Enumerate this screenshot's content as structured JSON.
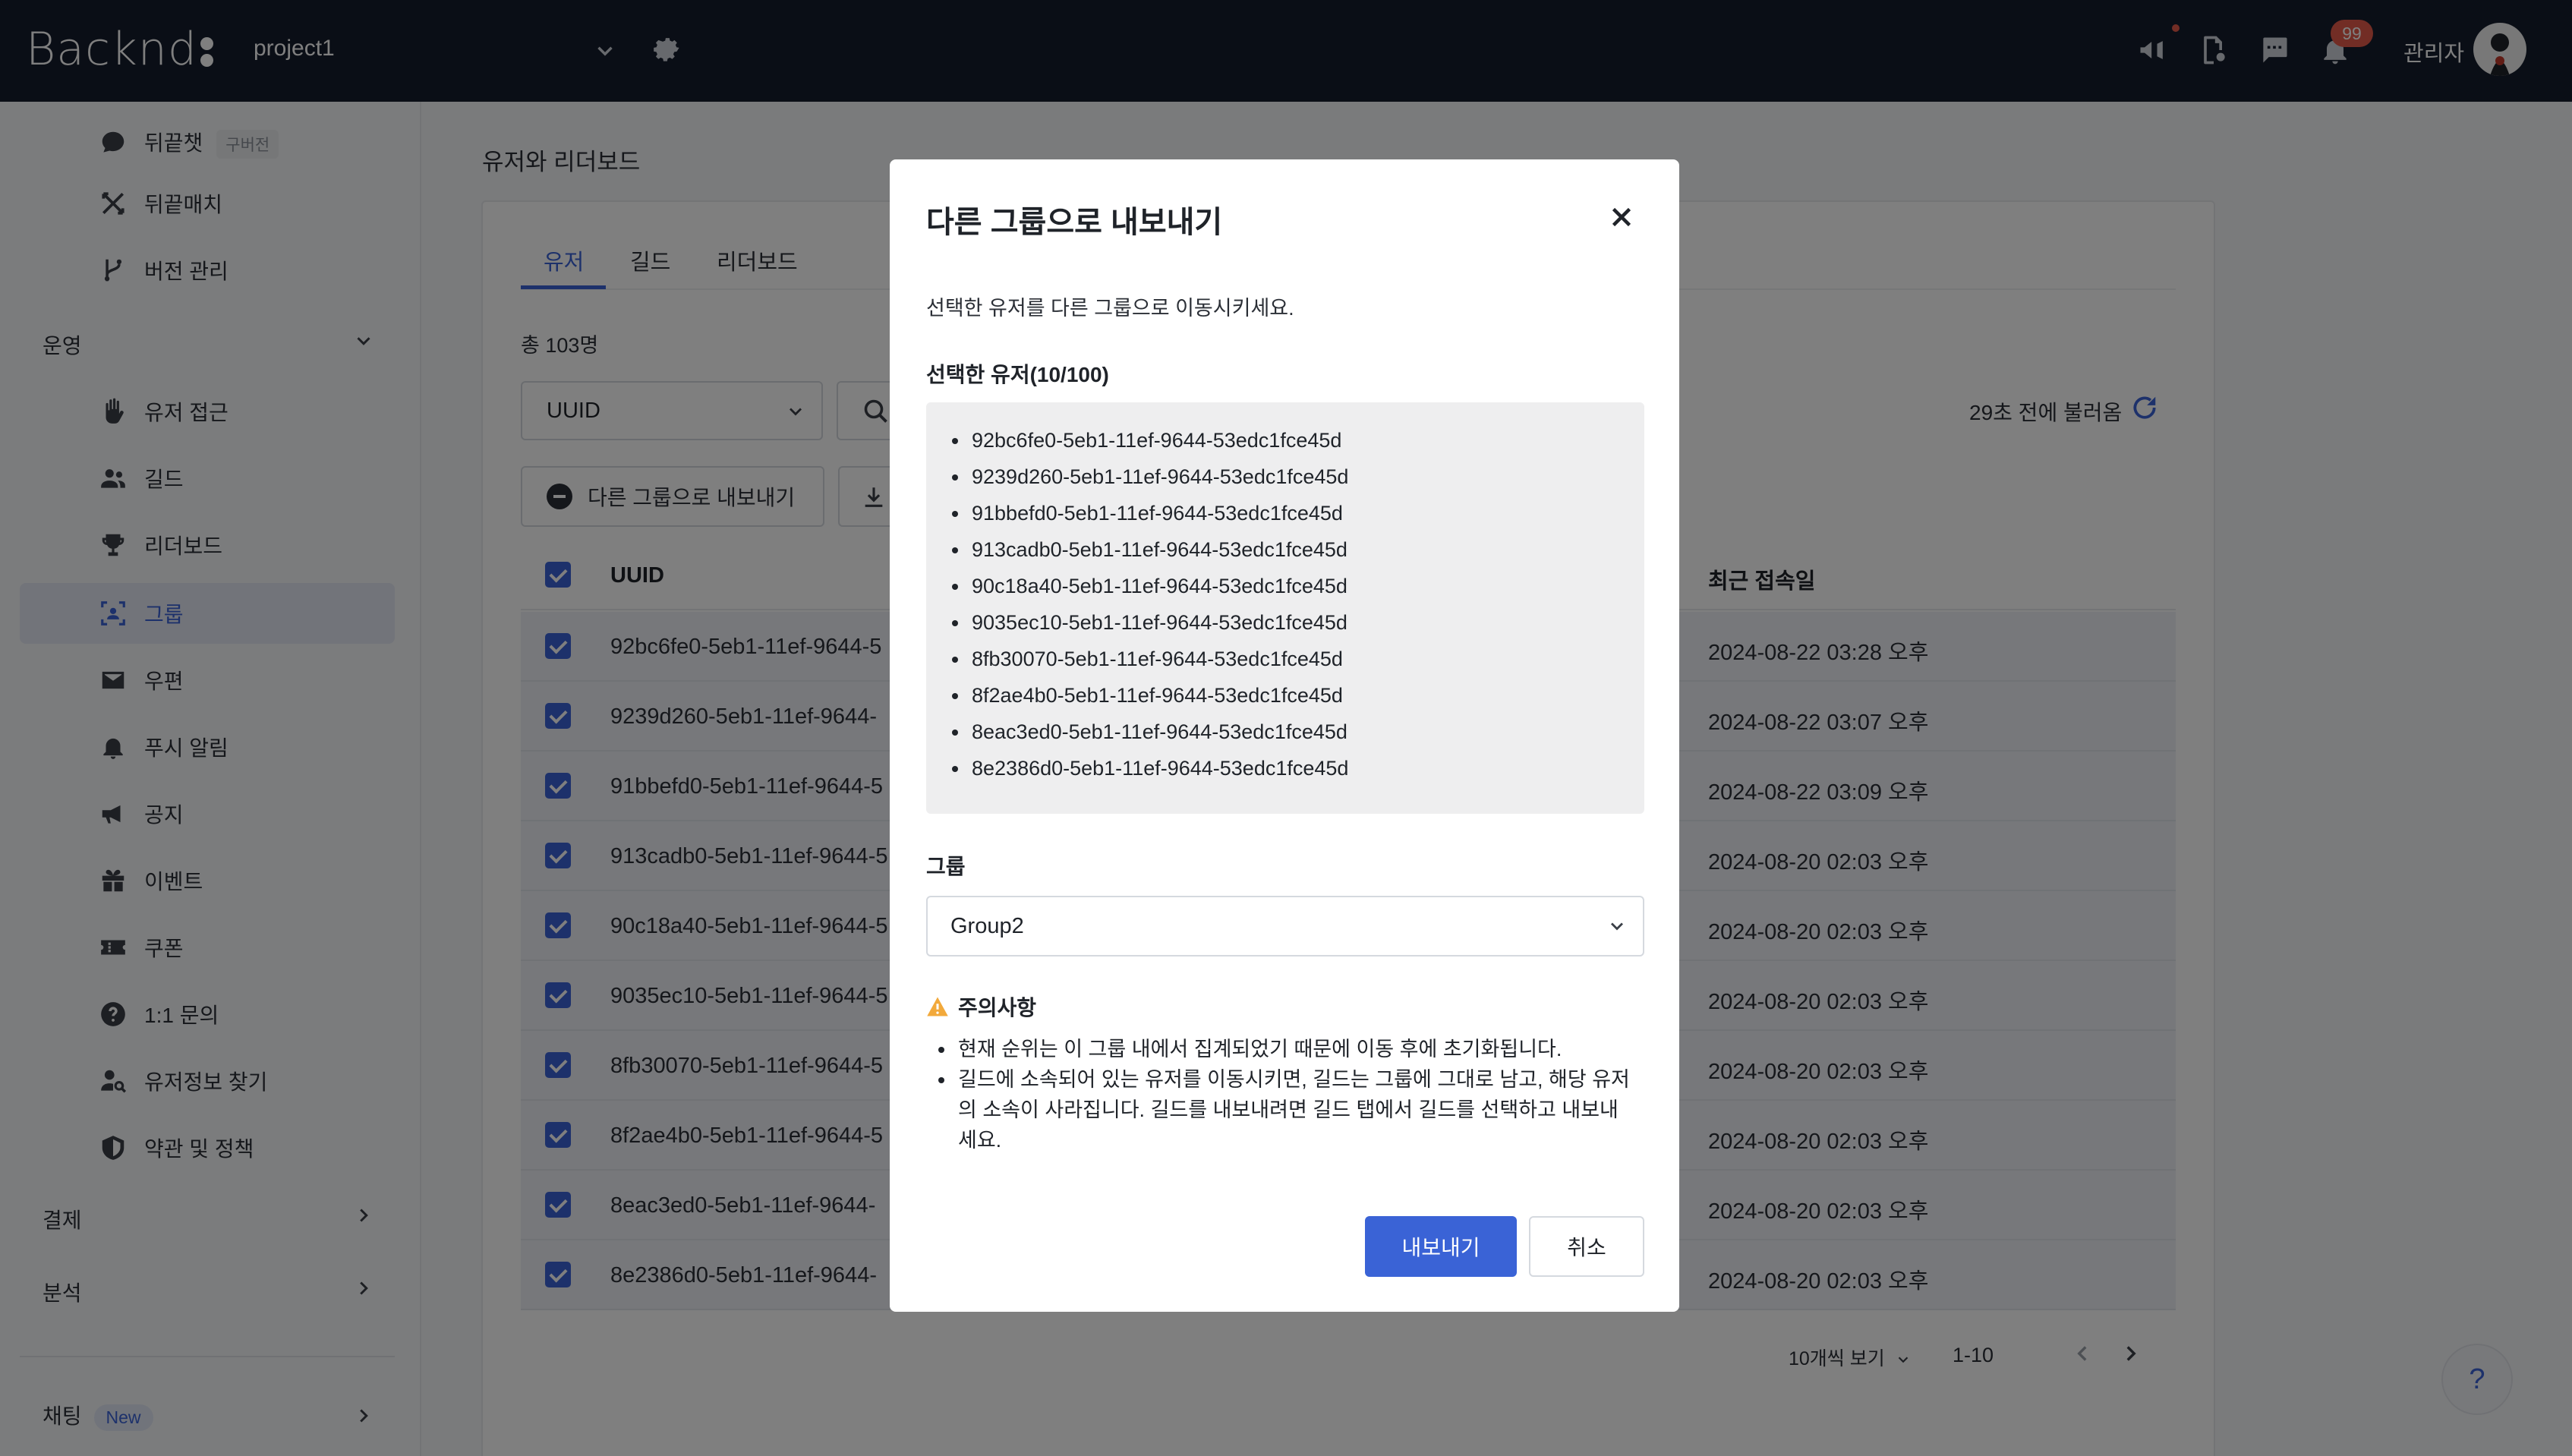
{
  "header": {
    "logo": "Backnd",
    "project": "project1",
    "admin": "관리자",
    "notification_count": "99"
  },
  "sidebar": {
    "items_top": [
      {
        "label": "뒤끝챗",
        "tag": "구버전",
        "icon": "chat-icon"
      },
      {
        "label": "뒤끝매치",
        "icon": "match-icon"
      },
      {
        "label": "버전 관리",
        "icon": "branch-icon"
      }
    ],
    "section_ops": "운영",
    "ops_items": [
      {
        "label": "유저 접근",
        "icon": "hand-icon"
      },
      {
        "label": "길드",
        "icon": "users-icon"
      },
      {
        "label": "리더보드",
        "icon": "trophy-icon"
      },
      {
        "label": "그룹",
        "icon": "group-icon"
      },
      {
        "label": "우편",
        "icon": "mail-icon"
      },
      {
        "label": "푸시 알림",
        "icon": "bell-icon"
      },
      {
        "label": "공지",
        "icon": "megaphone-icon"
      },
      {
        "label": "이벤트",
        "icon": "gift-icon"
      },
      {
        "label": "쿠폰",
        "icon": "ticket-icon"
      },
      {
        "label": "1:1 문의",
        "icon": "question-icon"
      },
      {
        "label": "유저정보 찾기",
        "icon": "user-search-icon"
      },
      {
        "label": "약관 및 정책",
        "icon": "shield-icon"
      }
    ],
    "section_payment": "결제",
    "section_analytics": "분석",
    "section_chat": "채팅",
    "chat_tag": "New"
  },
  "main": {
    "page_title": "유저와 리더보드",
    "tabs": [
      {
        "label": "유저"
      },
      {
        "label": "길드"
      },
      {
        "label": "리더보드"
      }
    ],
    "total": "총 103명",
    "filter_select": "UUID",
    "refresh_text": "29초 전에 불러옴",
    "export_button": "다른 그룹으로 내보내기",
    "columns": {
      "uuid": "UUID",
      "last_login": "최근 접속일"
    },
    "rows": [
      {
        "uuid": "92bc6fe0-5eb1-11ef-9644-5",
        "date": "2024-08-22 03:28 오후"
      },
      {
        "uuid": "9239d260-5eb1-11ef-9644-",
        "date": "2024-08-22 03:07 오후"
      },
      {
        "uuid": "91bbefd0-5eb1-11ef-9644-5",
        "date": "2024-08-22 03:09 오후"
      },
      {
        "uuid": "913cadb0-5eb1-11ef-9644-5",
        "date": "2024-08-20 02:03 오후"
      },
      {
        "uuid": "90c18a40-5eb1-11ef-9644-5",
        "date": "2024-08-20 02:03 오후"
      },
      {
        "uuid": "9035ec10-5eb1-11ef-9644-5",
        "date": "2024-08-20 02:03 오후"
      },
      {
        "uuid": "8fb30070-5eb1-11ef-9644-5",
        "date": "2024-08-20 02:03 오후"
      },
      {
        "uuid": "8f2ae4b0-5eb1-11ef-9644-5",
        "date": "2024-08-20 02:03 오후"
      },
      {
        "uuid": "8eac3ed0-5eb1-11ef-9644-",
        "date": "2024-08-20 02:03 오후"
      },
      {
        "uuid": "8e2386d0-5eb1-11ef-9644-",
        "date": "2024-08-20 02:03 오후"
      }
    ],
    "page_size": "10개씩 보기",
    "page_range": "1-10",
    "help": "?"
  },
  "modal": {
    "title": "다른 그룹으로 내보내기",
    "description": "선택한 유저를 다른 그룹으로 이동시키세요.",
    "selected_label": "선택한 유저(10/100)",
    "selected_users": [
      "92bc6fe0-5eb1-11ef-9644-53edc1fce45d",
      "9239d260-5eb1-11ef-9644-53edc1fce45d",
      "91bbefd0-5eb1-11ef-9644-53edc1fce45d",
      "913cadb0-5eb1-11ef-9644-53edc1fce45d",
      "90c18a40-5eb1-11ef-9644-53edc1fce45d",
      "9035ec10-5eb1-11ef-9644-53edc1fce45d",
      "8fb30070-5eb1-11ef-9644-53edc1fce45d",
      "8f2ae4b0-5eb1-11ef-9644-53edc1fce45d",
      "8eac3ed0-5eb1-11ef-9644-53edc1fce45d",
      "8e2386d0-5eb1-11ef-9644-53edc1fce45d"
    ],
    "group_label": "그룹",
    "group_value": "Group2",
    "warning_title": "주의사항",
    "warnings": [
      "현재 순위는 이 그룹 내에서 집계되었기 때문에 이동 후에 초기화됩니다.",
      "길드에 소속되어 있는 유저를 이동시키면, 길드는 그룹에 그대로 남고, 해당 유저의 소속이 사라집니다. 길드를 내보내려면 길드 탭에서 길드를 선택하고 내보내세요."
    ],
    "confirm_button": "내보내기",
    "cancel_button": "취소"
  },
  "colors": {
    "header_bg": "#151c2c",
    "accent": "#3a63d6",
    "badge": "#e45a4a",
    "warning": "#f2a93b"
  }
}
